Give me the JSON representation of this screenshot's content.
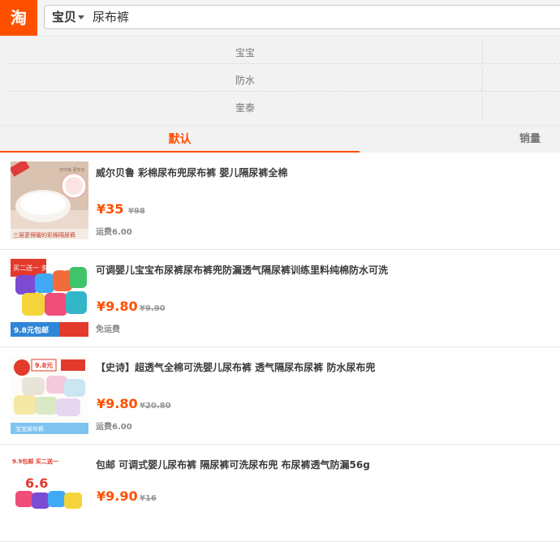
{
  "header": {
    "logo_text": "淘",
    "search_type": "宝贝",
    "search_query": "尿布裤"
  },
  "filters": [
    "宝宝",
    "防水",
    "奎泰"
  ],
  "sort": {
    "default_label": "默认",
    "sales_label": "销量"
  },
  "products": [
    {
      "title": "威尔贝鲁 彩棉尿布兜尿布裤 婴儿隔尿裤全棉",
      "price": "¥35",
      "original_price": "¥98",
      "shipping": "运费6.00",
      "thumb_icon": "diaper-photo-white",
      "thumb_texts": {
        "top": "无印染·更安全",
        "bottom": "三层更保暖的彩棉隔尿裤"
      }
    },
    {
      "title": "可调婴儿宝宝布尿裤尿布裤兜防漏透气隔尿裤训练里料纯棉防水可洗",
      "price": "¥9.80",
      "original_price": "¥9.90",
      "shipping": "免运费",
      "thumb_icon": "diaper-photo-colorful",
      "thumb_texts": {
        "top": "买二送一 多买多送",
        "bottom": "9.8元包邮"
      }
    },
    {
      "title": "【史诗】超透气全棉可洗婴儿尿布裤 透气隔尿布尿裤 防水尿布兜",
      "price": "¥9.80",
      "original_price": "¥20.80",
      "shipping": "运费6.00",
      "thumb_icon": "diaper-photo-pastel",
      "thumb_texts": {
        "top": "9.8元",
        "bottom": "宝宝尿布裤"
      }
    },
    {
      "title": "包邮 可调式婴儿尿布裤 隔尿裤可洗尿布兜 布尿裤透气防漏56g",
      "price": "¥9.90",
      "original_price": "¥16",
      "shipping": "",
      "thumb_icon": "diaper-photo-multi",
      "thumb_texts": {
        "top": "9.9包邮 买二送一",
        "bottom": "6.6"
      }
    }
  ],
  "colors": {
    "brand": "#ff5000"
  }
}
